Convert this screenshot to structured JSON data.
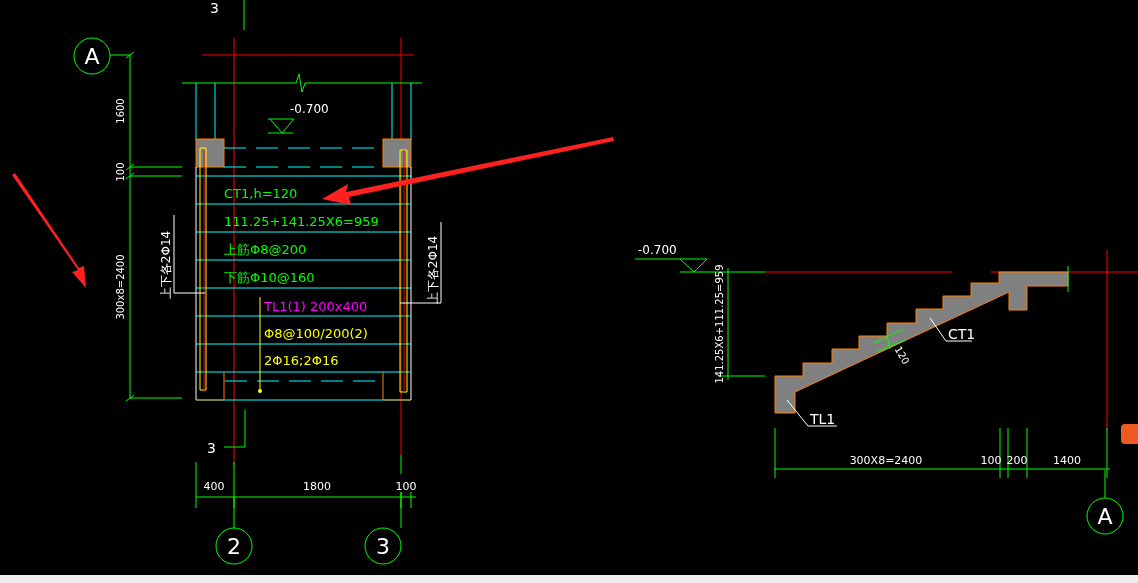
{
  "plan_view": {
    "section_marks": [
      {
        "label": "3"
      },
      {
        "label": "3"
      }
    ],
    "axis_bubbles": [
      {
        "label": "A"
      },
      {
        "label": "2"
      },
      {
        "label": "3"
      }
    ],
    "elevation": "-0.700",
    "vertical_dimensions": [
      "1600",
      "100",
      "300x8=2400"
    ],
    "horizontal_dimensions": [
      "400",
      "1800",
      "100"
    ],
    "side_rebar_labels": [
      "上下各2Φ14",
      "上下各2Φ14"
    ],
    "slab_notes": [
      "CT1,h=120",
      "111.25+141.25X6=959",
      "上筋Φ8@200",
      "下筋Φ10@160"
    ],
    "beam_notes": [
      {
        "text": "TL1(1) 200x400",
        "color": "#ff00ff"
      },
      {
        "text": "Φ8@100/200(2)",
        "color": "#ffff00"
      },
      {
        "text": "2Φ16;2Φ16",
        "color": "#ffff00"
      }
    ]
  },
  "section_view": {
    "elevation": "-0.700",
    "height_dimension": "141.25X6+111.25=959",
    "thickness_dimension": "120",
    "member_labels": [
      "CT1",
      "TL1"
    ],
    "horizontal_dimensions": [
      "300X8=2400",
      "100",
      "200",
      "1400"
    ],
    "axis_bubble": {
      "label": "A"
    }
  }
}
